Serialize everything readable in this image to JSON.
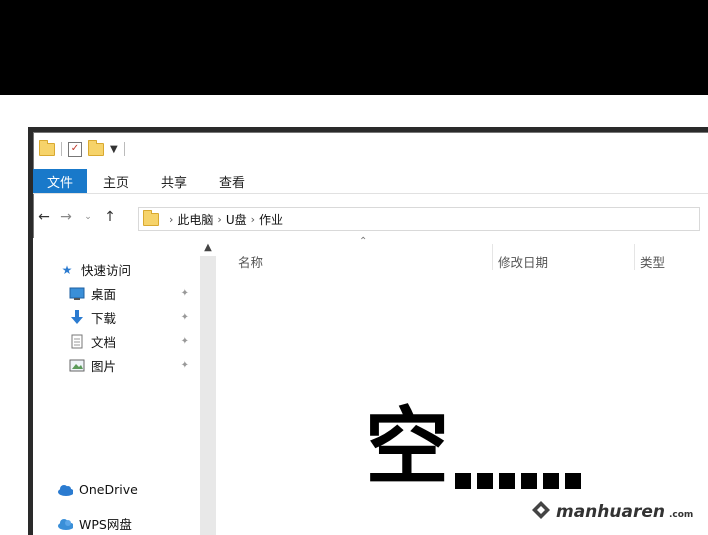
{
  "ribbon": {
    "tabs": [
      "文件",
      "主页",
      "共享",
      "查看"
    ]
  },
  "address": {
    "path": [
      "此电脑",
      "U盘",
      "作业"
    ]
  },
  "sidebar": {
    "quick_access": "快速访问",
    "items": [
      {
        "label": "桌面",
        "icon": "desktop-icon",
        "pinned": true
      },
      {
        "label": "下载",
        "icon": "download-icon",
        "pinned": true
      },
      {
        "label": "文档",
        "icon": "document-icon",
        "pinned": true
      },
      {
        "label": "图片",
        "icon": "picture-icon",
        "pinned": true
      }
    ],
    "onedrive": "OneDrive",
    "wps": "WPS网盘"
  },
  "columns": [
    "名称",
    "修改日期",
    "类型"
  ],
  "overlay": {
    "empty_text": "空"
  },
  "watermark": {
    "name": "manhuaren",
    "suffix": ".com"
  },
  "colors": {
    "file_tab": "#1979ca",
    "folder": "#f6d36a"
  }
}
